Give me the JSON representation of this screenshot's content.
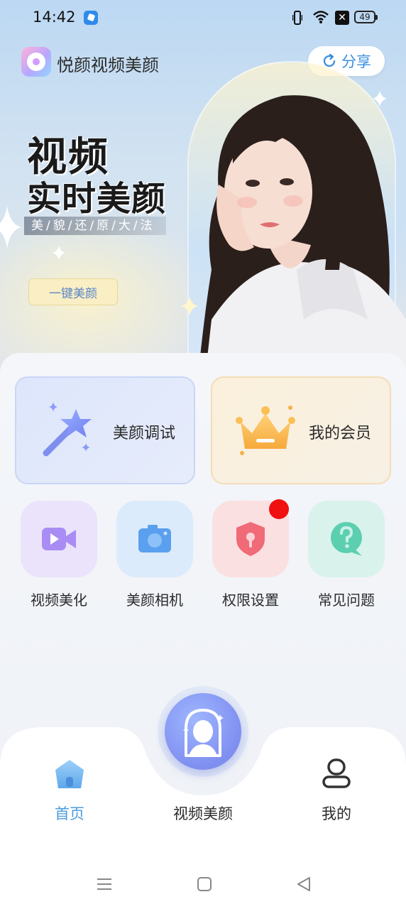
{
  "status_bar": {
    "time": "14:42",
    "battery": "49"
  },
  "header": {
    "app_title": "悦颜视频美颜",
    "share_label": "分享"
  },
  "hero": {
    "headline_line1": "视频",
    "headline_line2": "实时美颜",
    "slogan": "美/貌/还/原/大/法",
    "cta_label": "一键美颜"
  },
  "cards": [
    {
      "label": "美颜调试",
      "icon": "magic-wand-icon"
    },
    {
      "label": "我的会员",
      "icon": "crown-icon"
    }
  ],
  "grid": [
    {
      "label": "视频美化",
      "icon": "video-camera-icon",
      "color": "#a98cf4"
    },
    {
      "label": "美颜相机",
      "icon": "camera-icon",
      "color": "#5aa0ef"
    },
    {
      "label": "权限设置",
      "icon": "shield-lock-icon",
      "color": "#f06a78",
      "has_badge": true
    },
    {
      "label": "常见问题",
      "icon": "question-chat-icon",
      "color": "#5ccfb0"
    }
  ],
  "bottom_nav": {
    "home_label": "首页",
    "center_label": "视频美颜",
    "mine_label": "我的",
    "active": "首页",
    "active_color": "#4a9be0"
  }
}
